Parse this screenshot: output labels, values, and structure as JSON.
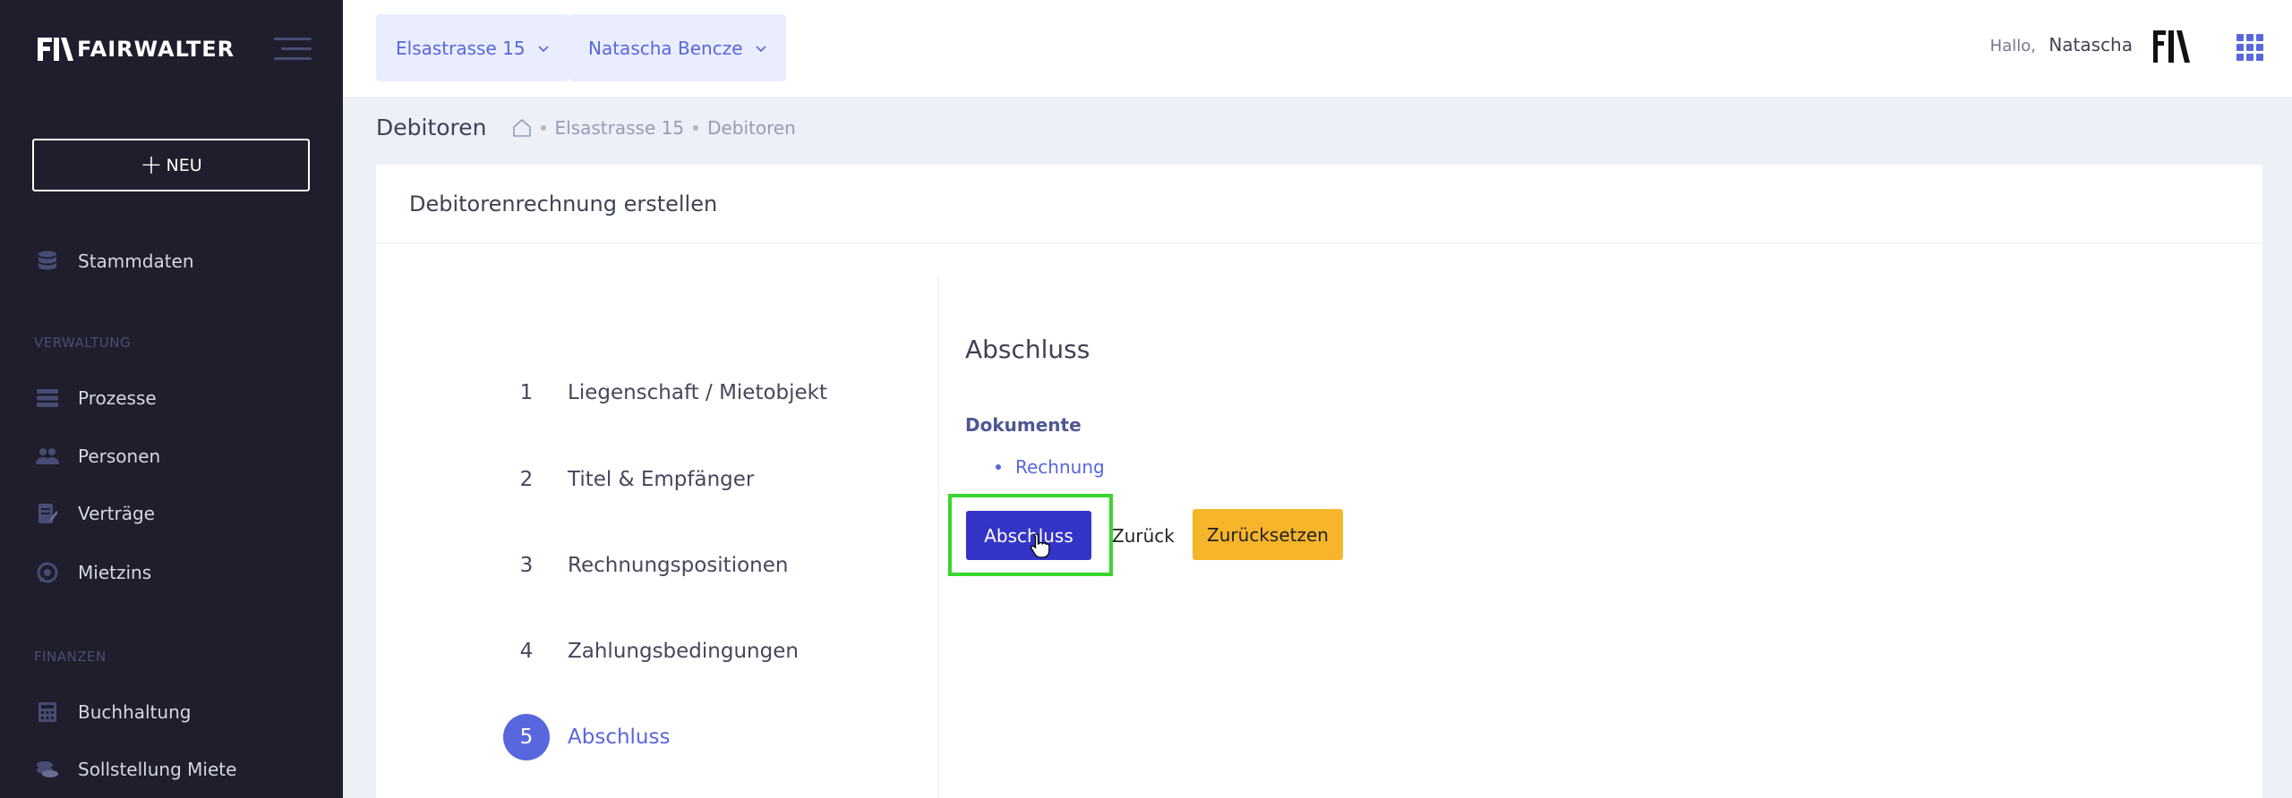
{
  "sidebar": {
    "brand": "FAIRWALTER",
    "new_button": "NEU",
    "items_top": [
      {
        "label": "Stammdaten",
        "icon": "database-icon"
      }
    ],
    "section_verwaltung": "VERWALTUNG",
    "items_verwaltung": [
      {
        "label": "Prozesse",
        "icon": "server-icon"
      },
      {
        "label": "Personen",
        "icon": "people-icon"
      },
      {
        "label": "Verträge",
        "icon": "contract-icon"
      },
      {
        "label": "Mietzins",
        "icon": "rent-icon"
      }
    ],
    "section_finanzen": "FINANZEN",
    "items_finanzen": [
      {
        "label": "Buchhaltung",
        "icon": "calculator-icon"
      },
      {
        "label": "Sollstellung Miete",
        "icon": "coins-icon"
      }
    ]
  },
  "topbar": {
    "property_select": "Elsastrasse 15",
    "person_select": "Natascha Bencze",
    "greeting": "Hallo,",
    "user_name": "Natascha"
  },
  "subheader": {
    "title": "Debitoren",
    "breadcrumb": [
      "Elsastrasse 15",
      "Debitoren"
    ]
  },
  "card": {
    "title": "Debitorenrechnung erstellen",
    "steps": [
      {
        "num": "1",
        "label": "Liegenschaft / Mietobjekt"
      },
      {
        "num": "2",
        "label": "Titel & Empfänger"
      },
      {
        "num": "3",
        "label": "Rechnungspositionen"
      },
      {
        "num": "4",
        "label": "Zahlungsbedingungen"
      },
      {
        "num": "5",
        "label": "Abschluss"
      }
    ],
    "active_step": "5",
    "section_title": "Abschluss",
    "documents_label": "Dokumente",
    "documents": [
      "Rechnung"
    ],
    "buttons": {
      "finish": "Abschluss",
      "back": "Zurück",
      "reset": "Zurücksetzen"
    }
  },
  "colors": {
    "sidebar_bg": "#1e1e2d",
    "accent": "#5867dd",
    "primary_button": "#3434c8",
    "reset_button": "#f7b52c",
    "highlight": "#39d62e"
  }
}
